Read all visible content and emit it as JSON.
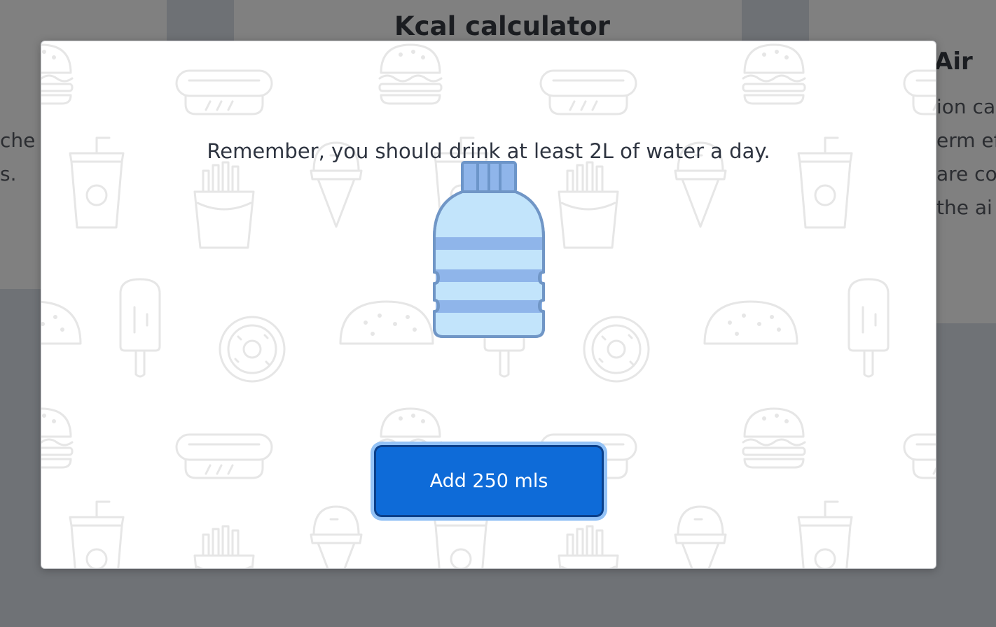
{
  "background": {
    "center_card_title": "Kcal calculator",
    "right_card_title_partial": "y Air",
    "right_card_lines": [
      "ion ca",
      "erm ef",
      "are co",
      "the ai"
    ],
    "left_card_lines": [
      "che",
      "s."
    ]
  },
  "modal": {
    "message": "Remember, you should drink at least 2L of water a day.",
    "button_label": "Add 250 mls",
    "illustration": "water-bottle-icon"
  },
  "colors": {
    "button": "#0e6bd8",
    "button_ring": "#93c2f6",
    "bottle_body": "#c2e4fb",
    "bottle_stripes": "#8fb5ea",
    "bottle_outline": "#7096c6",
    "overlay": "#6f7276"
  }
}
